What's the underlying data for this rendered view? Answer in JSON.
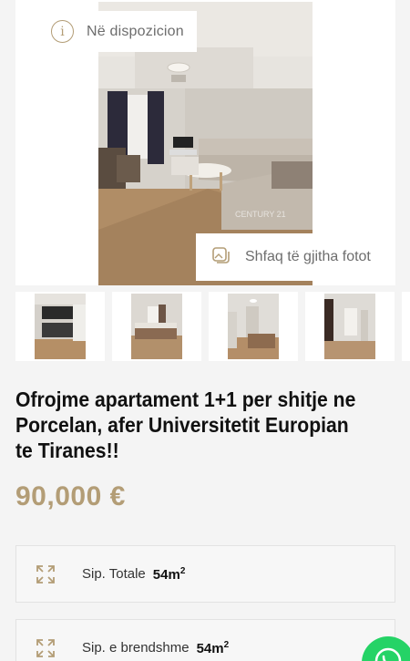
{
  "gallery": {
    "availability_label": "Në dispozicion",
    "show_all_label": "Shfaq të gjitha fotot",
    "watermark": "CENTURY 21",
    "thumbnails": [
      "kitchen",
      "bedroom",
      "hallway-bedroom",
      "hallway"
    ]
  },
  "listing": {
    "title": "Ofrojme apartament 1+1 per shitje ne Porcelan, afer Universitetit Europian te Tiranes!!",
    "price": "90,000 €"
  },
  "features": [
    {
      "label": "Sip. Totale",
      "value": "54m",
      "unit_sup": "2"
    },
    {
      "label": "Sip. e brendshme",
      "value": "54m",
      "unit_sup": "2"
    }
  ],
  "colors": {
    "accent": "#b39d76",
    "whatsapp": "#25d366"
  },
  "icons": {
    "info": "info-icon",
    "gallery": "gallery-icon",
    "area": "expand-icon",
    "chat": "whatsapp-icon"
  }
}
